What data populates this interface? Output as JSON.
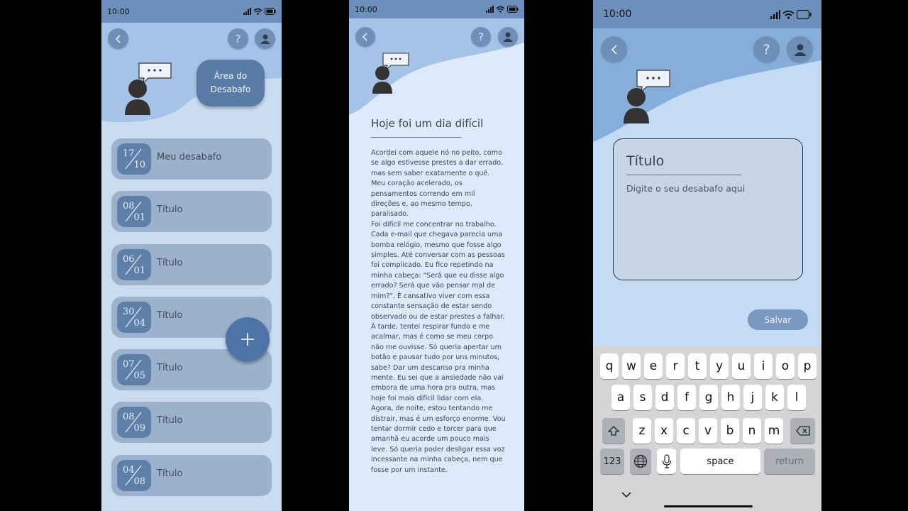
{
  "status": {
    "time": "10:00"
  },
  "screen1": {
    "area_button": {
      "line1": "Área do",
      "line2": "Desabafo"
    },
    "entries": [
      {
        "day": "17",
        "month": "10",
        "title": "Meu desabafo"
      },
      {
        "day": "08",
        "month": "01",
        "title": "Título"
      },
      {
        "day": "06",
        "month": "01",
        "title": "Título"
      },
      {
        "day": "30",
        "month": "04",
        "title": "Título"
      },
      {
        "day": "07",
        "month": "05",
        "title": "Título"
      },
      {
        "day": "08",
        "month": "09",
        "title": "Título"
      },
      {
        "day": "04",
        "month": "08",
        "title": "Título"
      }
    ],
    "fab_label": "+"
  },
  "screen2": {
    "title": "Hoje foi um dia difícil",
    "body": "Acordei com aquele nó no peito, como se algo estivesse prestes a dar errado, mas sem saber exatamente o quê. Meu coração acelerado, os pensamentos correndo em mil direções e, ao mesmo tempo, paralisado.\nFoi difícil me concentrar no trabalho. Cada e-mail que chegava parecia uma bomba relógio, mesmo que fosse algo simples. Até conversar com as pessoas foi complicado. Eu fico repetindo na minha cabeça: \"Será que eu disse algo errado? Será que vão pensar mal de mim?\". É cansativo viver com essa constante sensação de estar sendo observado ou de estar prestes a falhar.\nÀ tarde, tentei respirar fundo e me acalmar, mas é como se meu corpo não me ouvisse. Só queria apertar um botão e pausar tudo por uns minutos, sabe? Dar um descanso pra minha mente. Eu sei que a ansiedade não vai embora de uma hora pra outra, mas hoje foi mais difícil lidar com ela.\nAgora, de noite, estou tentando me distrair, mas é um esforço enorme. Vou tentar dormir cedo e torcer para que amanhã eu acorde um pouco mais leve. Só queria poder desligar essa voz incessante na minha cabeça, nem que fosse por um instante."
  },
  "screen3": {
    "title_placeholder": "Título",
    "body_placeholder": "Digite o seu desabafo aqui",
    "save_label": "Salvar",
    "keyboard": {
      "row1": [
        "q",
        "w",
        "e",
        "r",
        "t",
        "y",
        "u",
        "i",
        "o",
        "p"
      ],
      "row2": [
        "a",
        "s",
        "d",
        "f",
        "g",
        "h",
        "j",
        "k",
        "l"
      ],
      "row3": [
        "z",
        "x",
        "c",
        "v",
        "b",
        "n",
        "m"
      ],
      "numbers_label": "123",
      "space_label": "space",
      "return_label": "return"
    }
  },
  "colors": {
    "accent": "#5b7ba7",
    "entry_bg": "#9cb1cc",
    "fab": "#4e73a6"
  }
}
